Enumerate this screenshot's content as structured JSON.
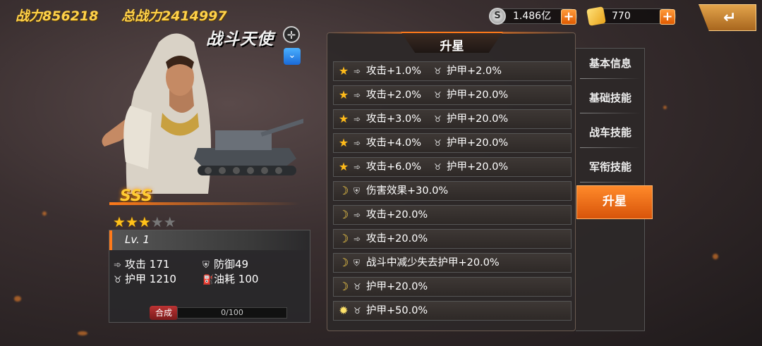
{
  "top": {
    "combat_power_label": "战力",
    "combat_power_value": "856218",
    "total_power_label": "总战力",
    "total_power_value": "2414997"
  },
  "resources": [
    {
      "icon": "silver-coin-icon",
      "value": "1.486亿"
    },
    {
      "icon": "gold-ingot-icon",
      "value": "770"
    }
  ],
  "hero": {
    "name": "战斗天使",
    "grade": "SSS",
    "stars_filled": 3,
    "stars_total": 5,
    "level": "Lv. 1",
    "stats": {
      "attack_label": "攻击",
      "attack_value": "171",
      "defense_label": "防御",
      "defense_value": "49",
      "armor_label": "护甲",
      "armor_value": "1210",
      "fuel_label": "油耗",
      "fuel_value": "100"
    },
    "merge_label": "合成",
    "merge_progress": "0/100"
  },
  "panel": {
    "title": "升星",
    "rows": [
      {
        "cond": "star",
        "effects": [
          "攻击+1.0%",
          "护甲+2.0%"
        ]
      },
      {
        "cond": "star",
        "effects": [
          "攻击+2.0%",
          "护甲+20.0%"
        ]
      },
      {
        "cond": "star",
        "effects": [
          "攻击+3.0%",
          "护甲+20.0%"
        ]
      },
      {
        "cond": "star",
        "effects": [
          "攻击+4.0%",
          "护甲+20.0%"
        ]
      },
      {
        "cond": "star",
        "effects": [
          "攻击+6.0%",
          "护甲+20.0%"
        ]
      },
      {
        "cond": "moon",
        "effects": [
          "伤害效果+30.0%"
        ]
      },
      {
        "cond": "moon",
        "effects": [
          "攻击+20.0%"
        ]
      },
      {
        "cond": "moon",
        "effects": [
          "攻击+20.0%"
        ]
      },
      {
        "cond": "moon",
        "effects": [
          "战斗中减少失去护甲+20.0%"
        ]
      },
      {
        "cond": "moon",
        "effects": [
          "护甲+20.0%"
        ]
      },
      {
        "cond": "sun",
        "effects": [
          "护甲+50.0%"
        ]
      }
    ]
  },
  "tabs": [
    "基本信息",
    "基础技能",
    "战车技能",
    "军衔技能",
    "升星"
  ],
  "active_tab": "升星",
  "colors": {
    "accent": "#ff7a1a",
    "gold": "#ffc21a"
  }
}
